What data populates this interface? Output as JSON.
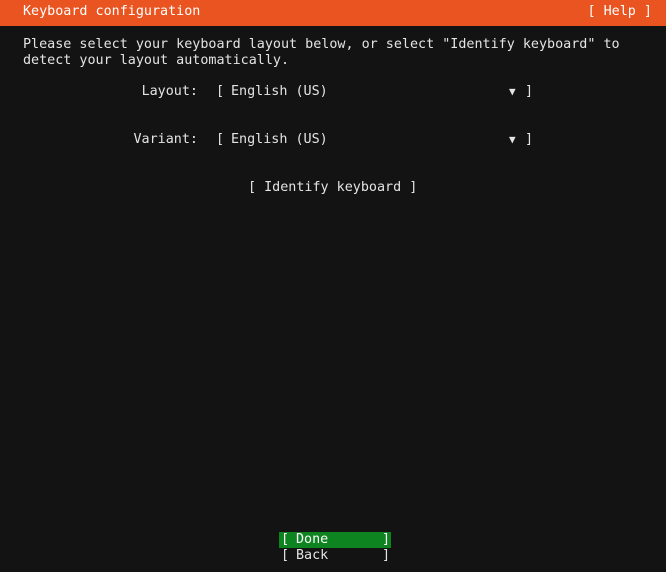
{
  "header": {
    "title": "Keyboard configuration",
    "help_label": "[ Help ]"
  },
  "intro": "Please select your keyboard layout below, or select \"Identify keyboard\" to detect your layout automatically.",
  "fields": [
    {
      "label": "Layout:",
      "value": "English (US)",
      "open_bracket": "[",
      "close_bracket": "]",
      "arrow": "▼"
    },
    {
      "label": "Variant:",
      "value": "English (US)",
      "open_bracket": "[",
      "close_bracket": "]",
      "arrow": "▼"
    }
  ],
  "identify_button": "[ Identify keyboard ]",
  "buttons": {
    "done": {
      "label": "Done",
      "open": "[",
      "close": "]"
    },
    "back": {
      "label": "Back",
      "open": "[",
      "close": "]"
    }
  },
  "colors": {
    "titlebar": "#e95420",
    "background": "#131313",
    "selected_button": "#0e8420"
  }
}
